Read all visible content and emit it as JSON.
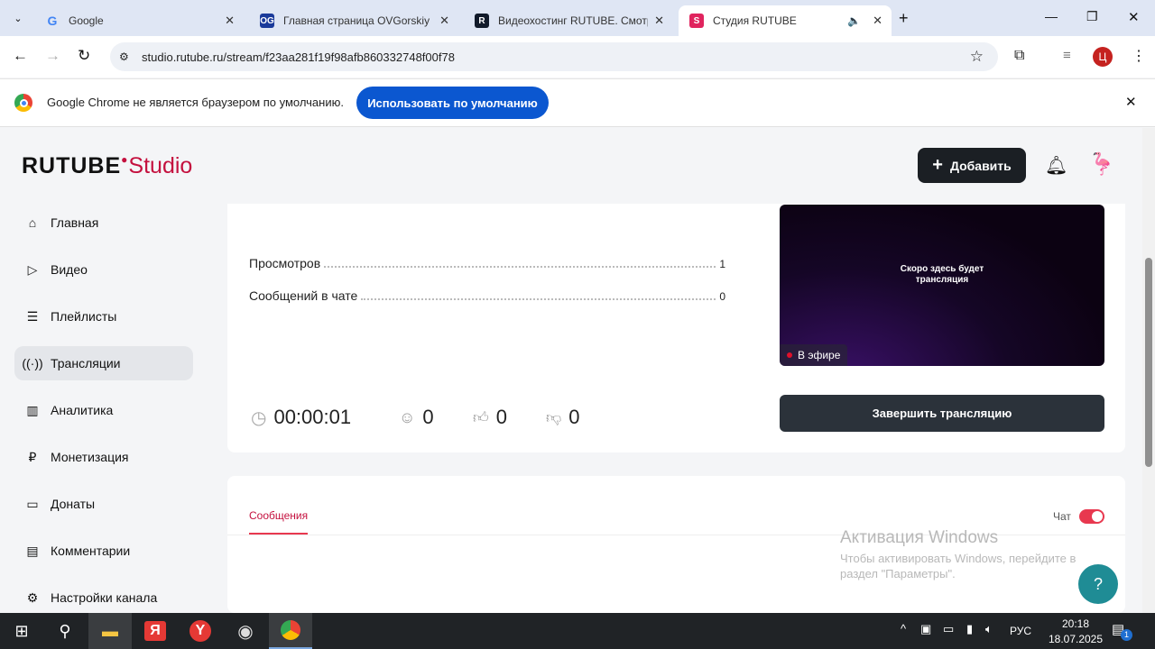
{
  "browser": {
    "tabs": [
      {
        "label": "Google"
      },
      {
        "label": "Главная страница OVGorskiy"
      },
      {
        "label": "Видеохостинг RUTUBE. Смотр"
      },
      {
        "label": "Студия RUTUBE"
      }
    ],
    "url": "studio.rutube.ru/stream/f23aa281f19f98afb860332748f00f78",
    "infobar_text": "Google Chrome не является браузером по умолчанию.",
    "infobar_button": "Использовать по умолчанию",
    "profile_letter": "Ц"
  },
  "header": {
    "logo_main": "RUTUBE",
    "logo_studio": "Studio",
    "add_label": "Добавить"
  },
  "sidebar": {
    "items": [
      {
        "label": "Главная"
      },
      {
        "label": "Видео"
      },
      {
        "label": "Плейлисты"
      },
      {
        "label": "Трансляции"
      },
      {
        "label": "Аналитика"
      },
      {
        "label": "Монетизация"
      },
      {
        "label": "Донаты"
      },
      {
        "label": "Комментарии"
      },
      {
        "label": "Настройки канала"
      }
    ]
  },
  "stream": {
    "stats": [
      {
        "label": "Просмотров",
        "value": "1"
      },
      {
        "label": "Сообщений в чате",
        "value": "0"
      }
    ],
    "duration": "00:00:01",
    "viewers": "0",
    "likes": "0",
    "dislikes": "0",
    "preview_text_1": "Скоро здесь будет",
    "preview_text_2": "трансляция",
    "live_badge": "В эфире",
    "end_button": "Завершить трансляцию"
  },
  "chat": {
    "tab_messages": "Сообщения",
    "chat_toggle_label": "Чат",
    "chat_enabled": true
  },
  "watermark": {
    "title": "Активация Windows",
    "line1": "Чтобы активировать Windows, перейдите в",
    "line2": "раздел \"Параметры\"."
  },
  "taskbar": {
    "lang": "РУС",
    "time": "20:18",
    "date": "18.07.2025",
    "notif_count": "1"
  },
  "colors": {
    "accent": "#c4103e",
    "toggle": "#e8384f",
    "chrome_blue": "#0b57d0"
  }
}
